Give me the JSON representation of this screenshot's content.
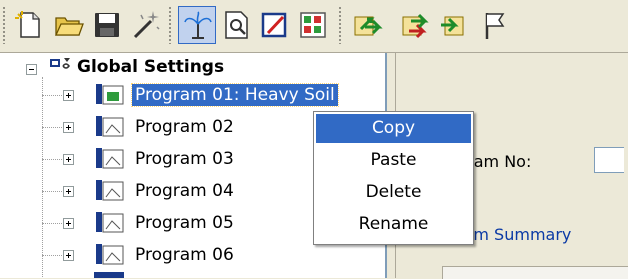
{
  "toolbar": {
    "buttons": [
      {
        "name": "new-file-icon"
      },
      {
        "name": "open-folder-icon"
      },
      {
        "name": "save-icon"
      },
      {
        "name": "magic-wand-icon"
      },
      {
        "name": "sprinkler-icon",
        "active": true
      },
      {
        "name": "preview-icon"
      },
      {
        "name": "edit-icon"
      },
      {
        "name": "grid-icon"
      },
      {
        "name": "send-green-icon"
      },
      {
        "name": "send-red-icon"
      },
      {
        "name": "receive-green-icon"
      },
      {
        "name": "flag-icon"
      }
    ]
  },
  "tree": {
    "root": {
      "label": "Global Settings",
      "expanded": true
    },
    "programs": [
      {
        "label": "Program 01: Heavy Soil",
        "selected": true
      },
      {
        "label": "Program 02"
      },
      {
        "label": "Program 03"
      },
      {
        "label": "Program 04"
      },
      {
        "label": "Program 05"
      },
      {
        "label": "Program 06"
      }
    ]
  },
  "panel": {
    "program_no_label": "gram No:",
    "program_summary_label": "ram Summary"
  },
  "context_menu": {
    "items": [
      {
        "label": "Copy",
        "highlighted": true
      },
      {
        "label": "Paste"
      },
      {
        "label": "Delete"
      },
      {
        "label": "Rename"
      }
    ]
  },
  "colors": {
    "selection": "#316ac5",
    "face": "#ece9d8",
    "link": "#0b3aa5"
  }
}
